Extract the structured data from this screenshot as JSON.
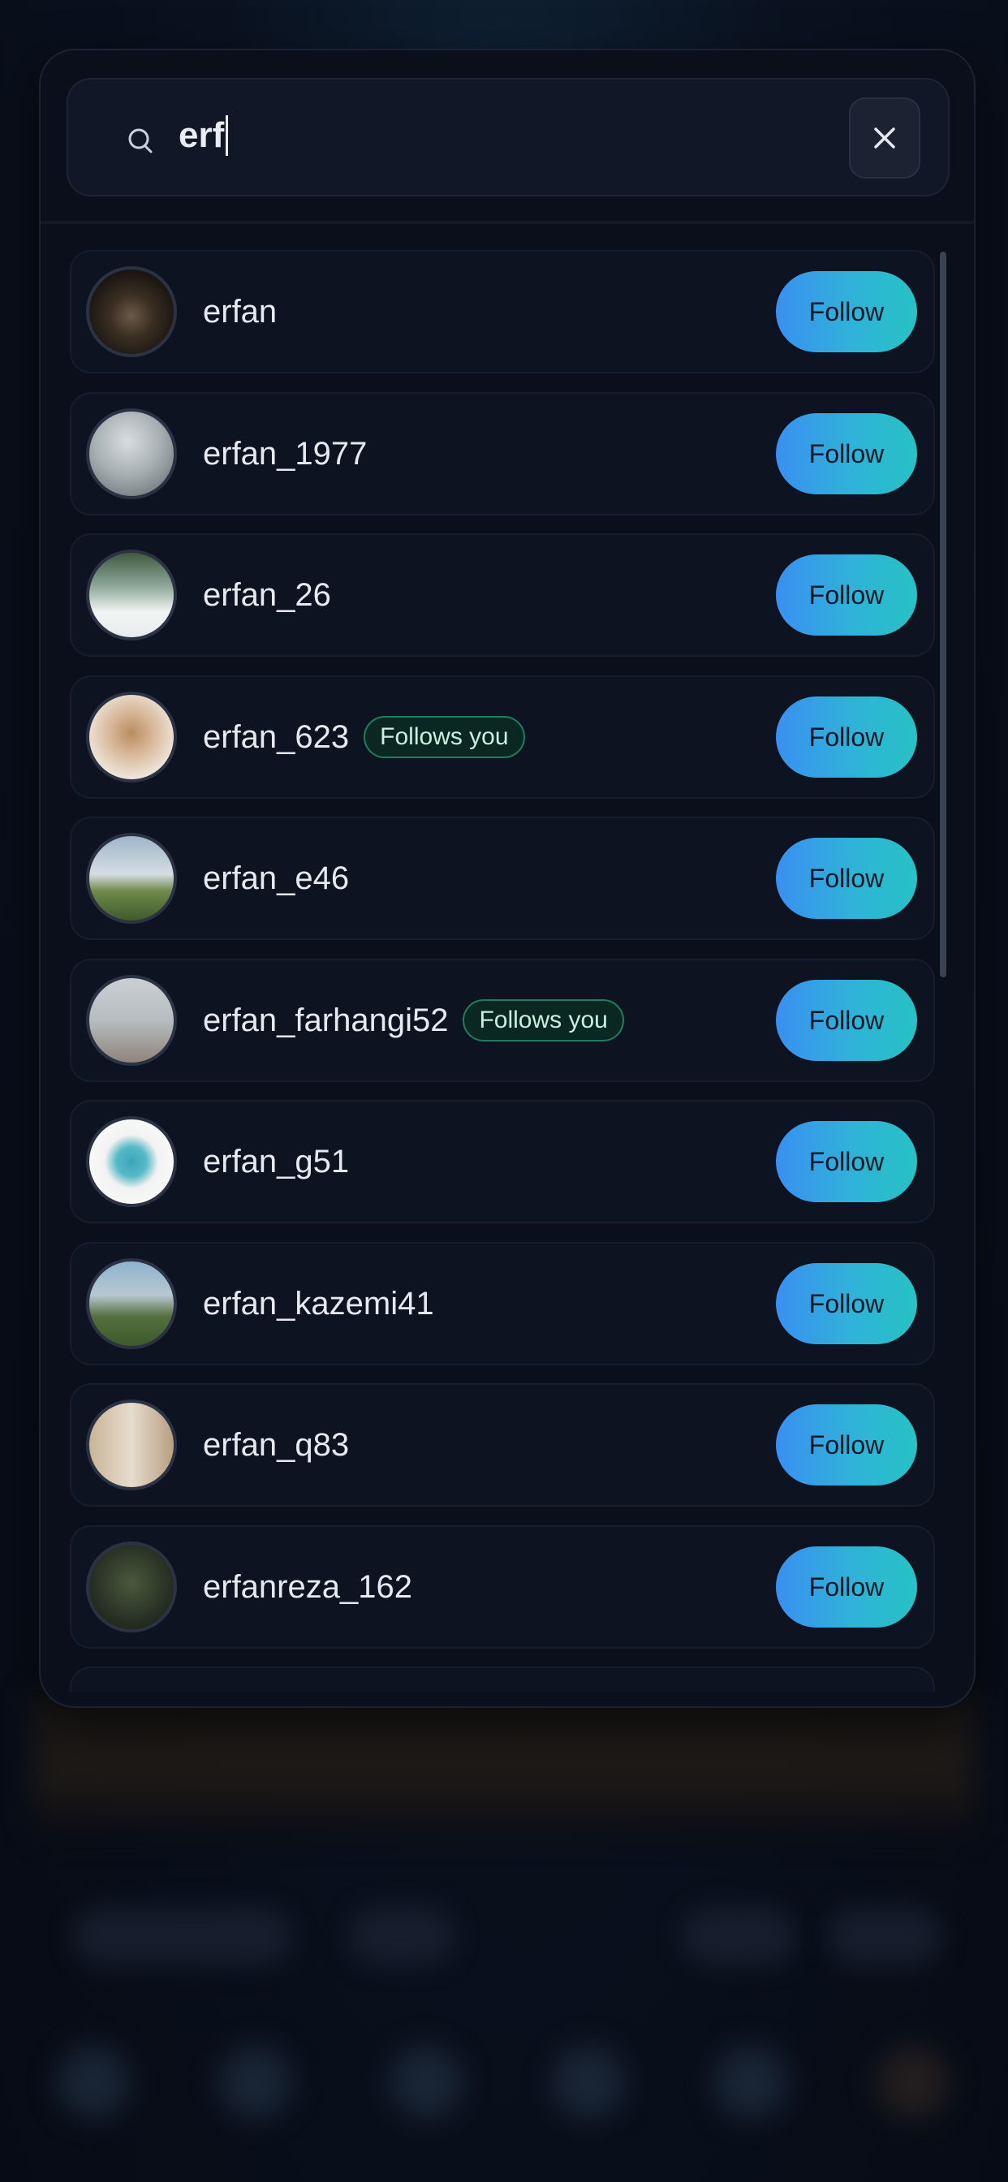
{
  "search": {
    "query": "erf"
  },
  "colors": {
    "panel_bg": "#0b0f1c",
    "follow_gradient_start": "#3a8ff0",
    "follow_gradient_end": "#26c2c4",
    "badge_border": "#1f7d5f"
  },
  "results": [
    {
      "username": "erfan",
      "follows_you": false,
      "follow_label": "Follow"
    },
    {
      "username": "erfan_1977",
      "follows_you": false,
      "follow_label": "Follow"
    },
    {
      "username": "erfan_26",
      "follows_you": false,
      "follow_label": "Follow"
    },
    {
      "username": "erfan_623",
      "follows_you": true,
      "badge_label": "Follows you",
      "follow_label": "Follow"
    },
    {
      "username": "erfan_e46",
      "follows_you": false,
      "follow_label": "Follow"
    },
    {
      "username": "erfan_farhangi52",
      "follows_you": true,
      "badge_label": "Follows you",
      "follow_label": "Follow"
    },
    {
      "username": "erfan_g51",
      "follows_you": false,
      "follow_label": "Follow"
    },
    {
      "username": "erfan_kazemi41",
      "follows_you": false,
      "follow_label": "Follow"
    },
    {
      "username": "erfan_q83",
      "follows_you": false,
      "follow_label": "Follow"
    },
    {
      "username": "erfanreza_162",
      "follows_you": false,
      "follow_label": "Follow"
    }
  ]
}
